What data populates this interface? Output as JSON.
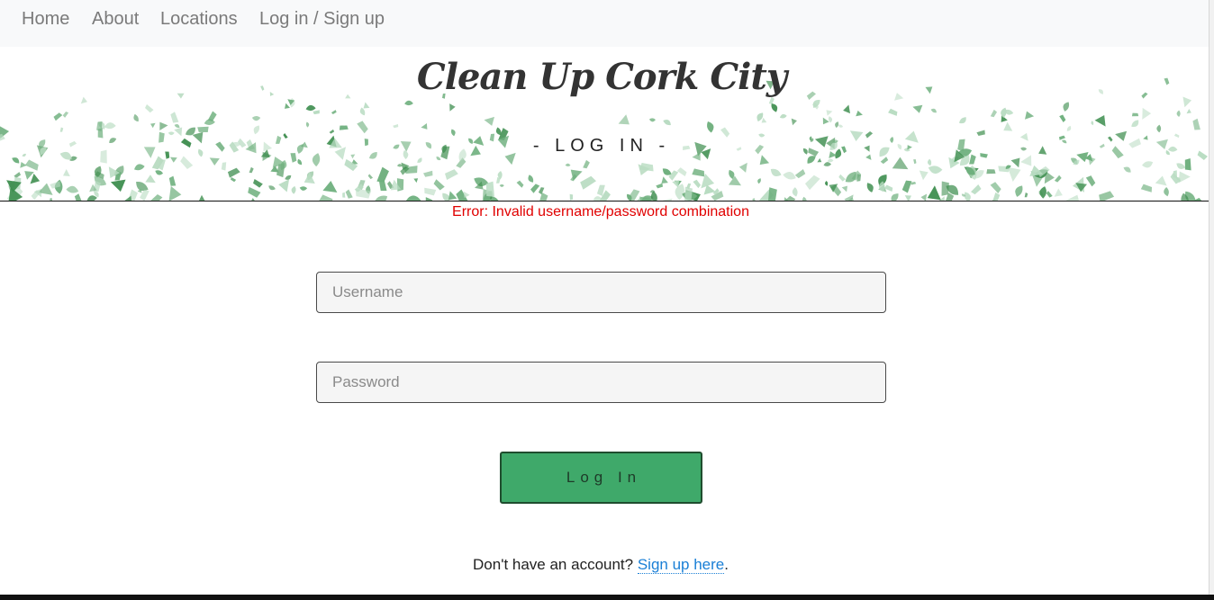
{
  "nav": {
    "items": [
      {
        "label": "Home"
      },
      {
        "label": "About"
      },
      {
        "label": "Locations"
      },
      {
        "label": "Log in / Sign up"
      }
    ]
  },
  "header": {
    "site_title": "Clean Up Cork City",
    "page_heading": "- LOG IN -"
  },
  "login": {
    "error": "Error: Invalid username/password combination",
    "username_placeholder": "Username",
    "password_placeholder": "Password",
    "button_label": "Log In"
  },
  "signup": {
    "prompt": "Don't have an account?",
    "link_label": "Sign up here",
    "trailing": "."
  },
  "colors": {
    "leaf_dark": "#3e8e4f",
    "leaf_mid": "#6fb07e",
    "leaf_light": "#b9dcc2",
    "button_green": "#3fa96a",
    "error_red": "#e00000",
    "link_blue": "#1a7fd6"
  }
}
